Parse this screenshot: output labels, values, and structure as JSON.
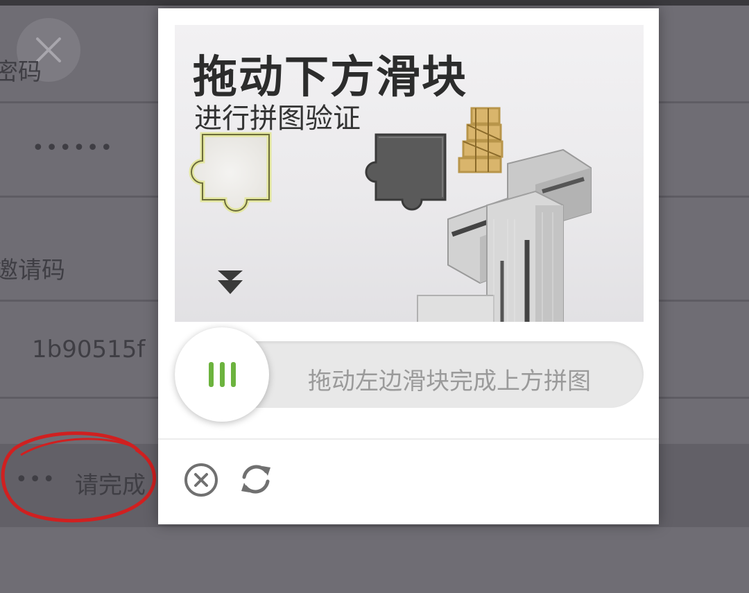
{
  "background_form": {
    "password_label": "密码",
    "password_value": "••••••",
    "invite_label": "邀请码",
    "invite_value": "1b90515f",
    "captcha_dots": "•••",
    "captcha_hint": "请完成"
  },
  "captcha": {
    "title": "拖动下方滑块",
    "subtitle": "进行拼图验证",
    "slider_hint": "拖动左边滑块完成上方拼图",
    "slider_position": 0
  },
  "icons": {
    "background_close": "close-icon",
    "grip": "grip-lines-icon",
    "arrow": "double-down-arrow-icon",
    "close": "close-circle-icon",
    "refresh": "refresh-icon"
  },
  "colors": {
    "grip_green": "#6cb33e",
    "overlay": "#6f6d74",
    "annotation_red": "#d02020"
  }
}
